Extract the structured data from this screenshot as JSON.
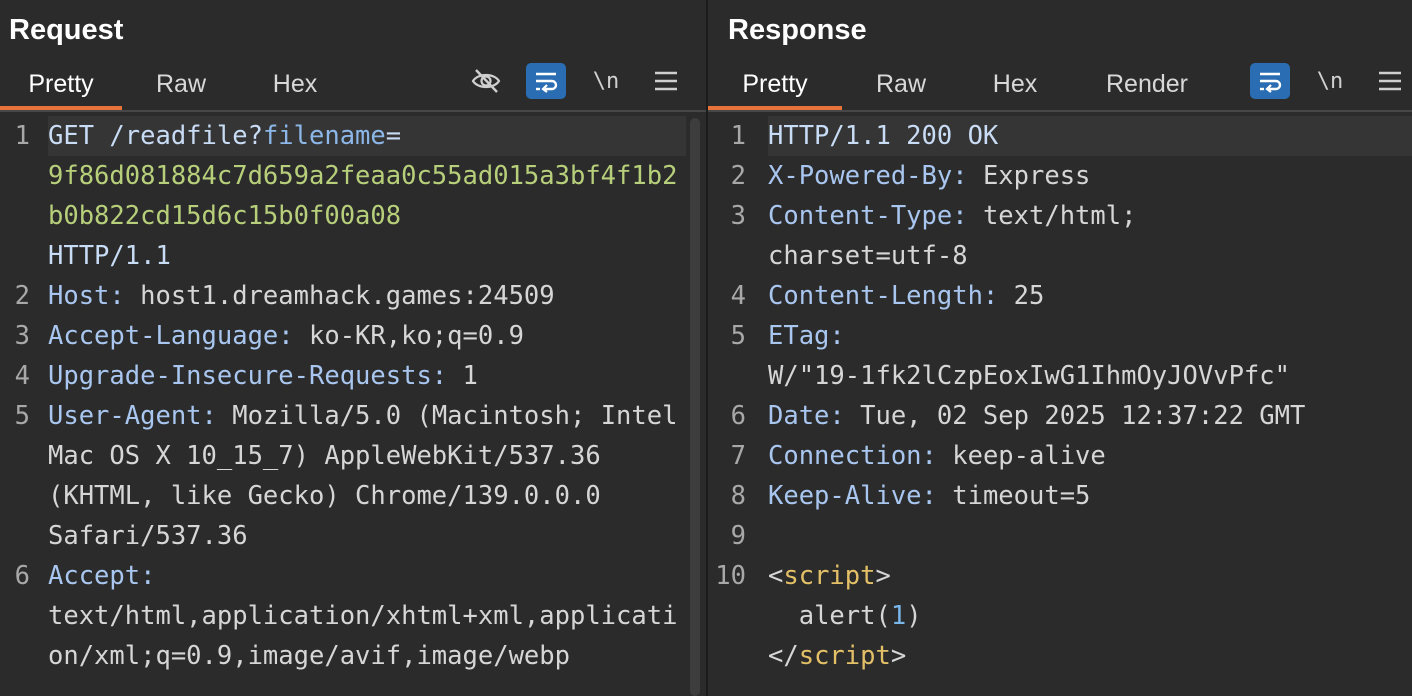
{
  "request": {
    "title": "Request",
    "tabs": [
      "Pretty",
      "Raw",
      "Hex"
    ],
    "active_tab": "Pretty",
    "tools": {
      "hide_icon": "eye-slash-icon",
      "wrap_icon": "wrap-lines-icon",
      "newline_label": "\\n",
      "menu_icon": "hamburger-menu-icon"
    },
    "lines": [
      {
        "n": "1",
        "method": "GET /readfile?",
        "param": "filename",
        "eq": "=",
        "value": "9f86d081884c7d659a2feaa0c55ad015a3bf4f1b2b0b822cd15d6c15b0f00a08",
        "proto": "HTTP/1.1"
      },
      {
        "n": "2",
        "name": "Host:",
        "value": " host1.dreamhack.games:24509"
      },
      {
        "n": "3",
        "name": "Accept-Language:",
        "value": " ko-KR,ko;q=0.9"
      },
      {
        "n": "4",
        "name": "Upgrade-Insecure-Requests:",
        "value": " 1"
      },
      {
        "n": "5",
        "name": "User-Agent:",
        "value": " Mozilla/5.0 (Macintosh; Intel Mac OS X 10_15_7) AppleWebKit/537.36 (KHTML, like Gecko) Chrome/139.0.0.0 Safari/537.36"
      },
      {
        "n": "6",
        "name": "Accept:",
        "value": "text/html,application/xhtml+xml,application/xml;q=0.9,image/avif,image/webp"
      }
    ]
  },
  "response": {
    "title": "Response",
    "tabs": [
      "Pretty",
      "Raw",
      "Hex",
      "Render"
    ],
    "active_tab": "Pretty",
    "tools": {
      "wrap_icon": "wrap-lines-icon",
      "newline_label": "\\n",
      "menu_icon": "hamburger-menu-icon"
    },
    "status_line": "HTTP/1.1 200 OK",
    "headers": [
      {
        "n": "2",
        "name": "X-Powered-By:",
        "value": " Express"
      },
      {
        "n": "3",
        "name": "Content-Type:",
        "value": " text/html;",
        "cont": "charset=utf-8"
      },
      {
        "n": "4",
        "name": "Content-Length:",
        "value": " 25"
      },
      {
        "n": "5",
        "name": "ETag:",
        "value": "",
        "cont": "W/\"19-1fk2lCzpEoxIwG1IhmOyJOVvPfc\""
      },
      {
        "n": "6",
        "name": "Date:",
        "value": " Tue, 02 Sep 2025 12:37:22 GMT"
      },
      {
        "n": "7",
        "name": "Connection:",
        "value": " keep-alive"
      },
      {
        "n": "8",
        "name": "Keep-Alive:",
        "value": " timeout=5"
      }
    ],
    "blank_line_no": "9",
    "body": {
      "n": "10",
      "open_lt": "<",
      "open_tag": "script",
      "open_gt": ">",
      "call": "  alert(",
      "arg": "1",
      "call_end": ")",
      "close_lt": "</",
      "close_tag": "script",
      "close_gt": ">"
    }
  }
}
